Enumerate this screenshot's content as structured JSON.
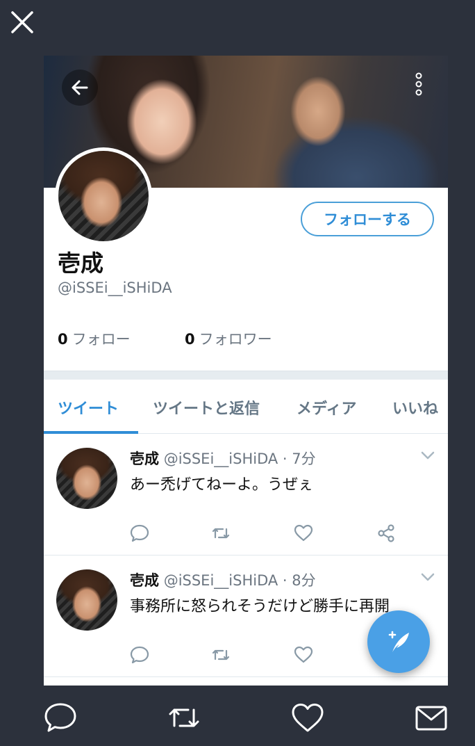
{
  "profile": {
    "display_name": "壱成",
    "handle": "@iSSEi__iSHiDA",
    "follow_button_label": "フォローする",
    "following_count": "0",
    "following_label": "フォロー",
    "followers_count": "0",
    "followers_label": "フォロワー"
  },
  "tabs": [
    {
      "label": "ツイート",
      "active": true
    },
    {
      "label": "ツイートと返信",
      "active": false
    },
    {
      "label": "メディア",
      "active": false
    },
    {
      "label": "いいね",
      "active": false
    }
  ],
  "tweets": [
    {
      "name": "壱成",
      "handle": "@iSSEi__iSHiDA",
      "time": "7分",
      "text": "あー禿げてねーよ。うぜぇ"
    },
    {
      "name": "壱成",
      "handle": "@iSSEi__iSHiDA",
      "time": "8分",
      "text": "事務所に怒られそうだけど勝手に再開"
    }
  ],
  "icons": {
    "close": "close-icon",
    "back": "arrow-left-icon",
    "menu": "more-vertical-icon",
    "reply": "reply-icon",
    "retweet": "retweet-icon",
    "like": "heart-icon",
    "share": "share-icon",
    "compose": "compose-quill-icon",
    "mail": "mail-icon"
  },
  "colors": {
    "accent": "#2f8dd6",
    "background": "#2c313c",
    "fab": "#4aa0e6"
  }
}
